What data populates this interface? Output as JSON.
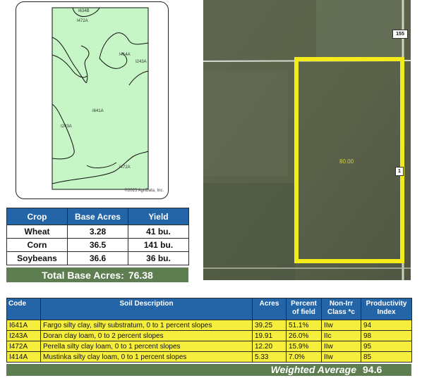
{
  "soil_map": {
    "labels": [
      "I634B",
      "I472A",
      "I414A",
      "I243A",
      "I641A",
      "I243A",
      "I472A"
    ],
    "copyright": "©2025 AgriData, Inc."
  },
  "crop_table": {
    "headers": [
      "Crop",
      "Base Acres",
      "Yield"
    ],
    "rows": [
      [
        "Wheat",
        "3.28",
        "41 bu."
      ],
      [
        "Corn",
        "36.5",
        "141 bu."
      ],
      [
        "Soybeans",
        "36.6",
        "36 bu."
      ]
    ],
    "total_label": "Total Base Acres:",
    "total_value": "76.38"
  },
  "aerial": {
    "field_acres": "80.00",
    "shields": [
      "155",
      "1"
    ],
    "accent_color": "#f4ec18"
  },
  "soil_table": {
    "headers": [
      "Code",
      "Soil Description",
      "Acres",
      "Percent of field",
      "Non-Irr Class *c",
      "Productivity Index"
    ],
    "rows": [
      [
        "I641A",
        "Fargo silty clay, silty substratum, 0 to 1 percent slopes",
        "39.25",
        "51.1%",
        "IIw",
        "94"
      ],
      [
        "I243A",
        "Doran clay loam, 0 to 2 percent slopes",
        "19.91",
        "26.0%",
        "IIc",
        "98"
      ],
      [
        "I472A",
        "Perella silty clay loam, 0 to 1 percent slopes",
        "12.20",
        "15.9%",
        "IIw",
        "95"
      ],
      [
        "I414A",
        "Mustinka silty clay loam, 0 to 1 percent slopes",
        "5.33",
        "7.0%",
        "IIw",
        "85"
      ]
    ],
    "weighted_label": "Weighted Average",
    "weighted_value": "94.6"
  }
}
